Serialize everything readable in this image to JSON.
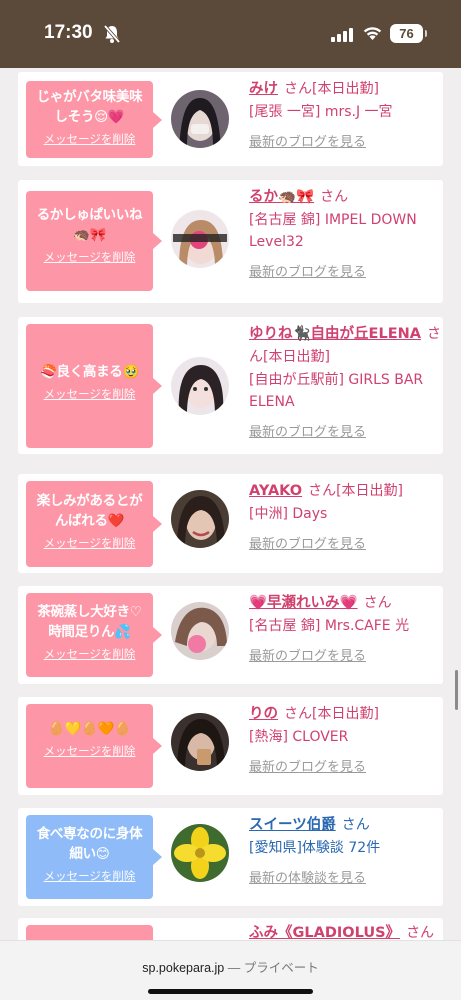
{
  "status_bar": {
    "time": "17:30",
    "battery": "76"
  },
  "browser": {
    "domain": "sp.pokepara.jp",
    "separator": "—",
    "mode": "プライベート"
  },
  "common": {
    "delete_label": "メッセージを削除",
    "san": "さん"
  },
  "cards": [
    {
      "message": "じゃがバタ味美味しそう😌💗",
      "name": "みけ",
      "status": "[本日出勤]",
      "line2": "[尾張 一宮] mrs.J 一宮",
      "link": "最新のブログを見る"
    },
    {
      "message": "るかしゅぱいいね🦔🎀",
      "name": "るか🦔🎀",
      "status": "",
      "line2": "[名古屋 錦] IMPEL DOWN Level32",
      "link": "最新のブログを見る"
    },
    {
      "message": "🍣良く高まる🥹",
      "name": "ゆりね🐈‍⬛自由が丘ELENA",
      "status": "[本日出勤]",
      "line2": "[自由が丘駅前] GIRLS BAR ELENA",
      "link": "最新のブログを見る"
    },
    {
      "message": "楽しみがあるとがんばれる❤️",
      "name": "AYAKO",
      "status": "[本日出勤]",
      "line2": "[中洲] Days",
      "link": "最新のブログを見る"
    },
    {
      "message": "茶碗蒸し大好き♡時間足りん💦",
      "name": "💗早瀬れいみ💗",
      "status": "",
      "line2": "[名古屋 錦] Mrs.CAFE 光",
      "link": "最新のブログを見る"
    },
    {
      "message": "🥚💛🥚🧡🥚",
      "name": "りの",
      "status": "[本日出勤]",
      "line2": "[熱海] CLOVER",
      "link": "最新のブログを見る"
    },
    {
      "message": "食べ専なのに身体細い😊",
      "name": "スイーツ伯爵",
      "status": "",
      "line2": "[愛知県]体験談 72件",
      "link": "最新の体験談を見る"
    },
    {
      "message": "",
      "name": "ふみ《GLADIOLUS》",
      "status": "",
      "line2": "",
      "link": ""
    }
  ],
  "colors": {
    "brand_brown": "#5b4a39",
    "bubble_pink": "#fd97a8",
    "bubble_blue": "#8fbbf9",
    "name_pink": "#d0416f",
    "name_blue": "#2a68b2"
  },
  "icons": [
    "bell-muted-icon",
    "cellular-signal-icon",
    "wifi-icon",
    "battery-icon"
  ]
}
